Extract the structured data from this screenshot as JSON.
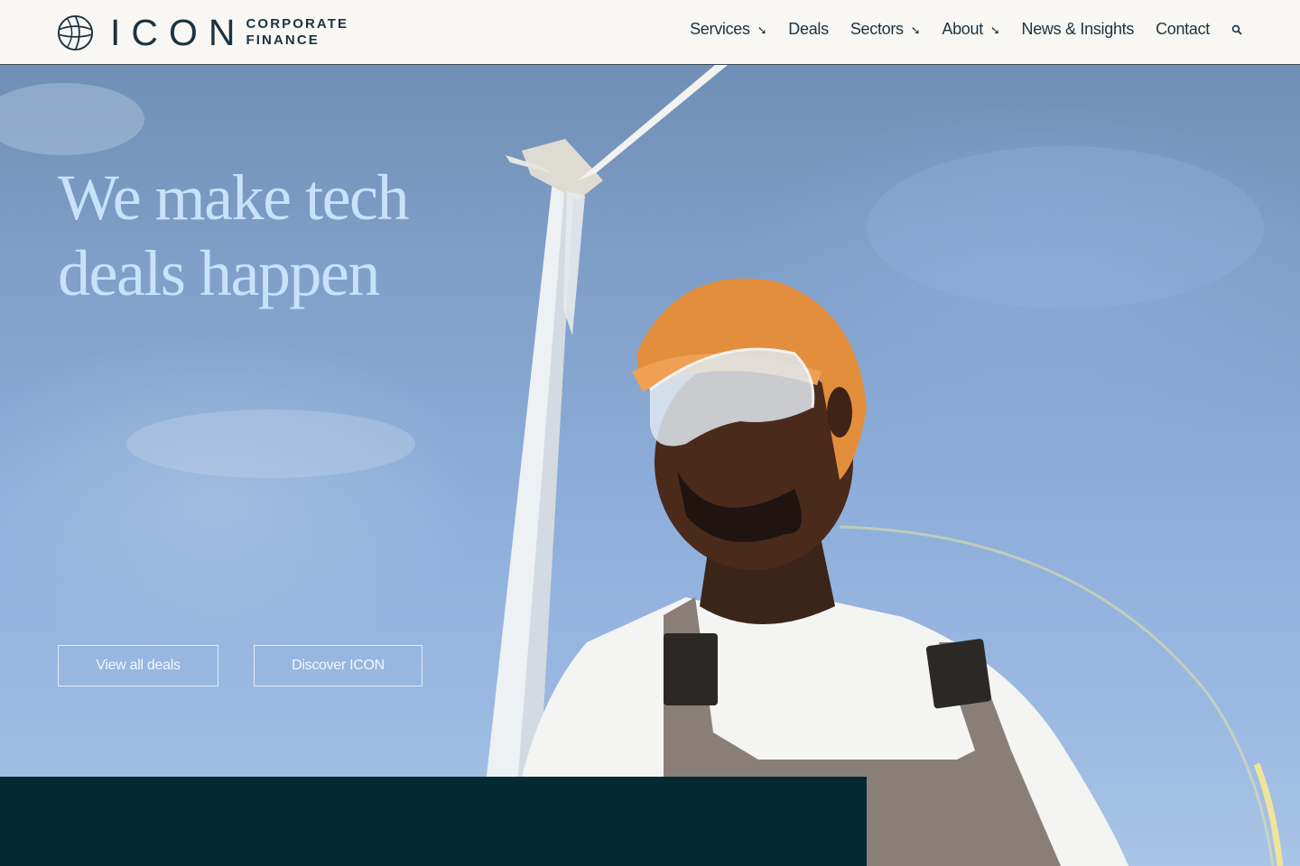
{
  "brand": {
    "name": "ICON",
    "sub_line_1": "CORPORATE",
    "sub_line_2": "FINANCE",
    "logo_icon": "globe-icon"
  },
  "nav": {
    "items": [
      {
        "label": "Services",
        "has_dropdown": true
      },
      {
        "label": "Deals",
        "has_dropdown": false
      },
      {
        "label": "Sectors",
        "has_dropdown": true
      },
      {
        "label": "About",
        "has_dropdown": true
      },
      {
        "label": "News & Insights",
        "has_dropdown": false
      },
      {
        "label": "Contact",
        "has_dropdown": false
      }
    ],
    "dropdown_icon": "arrow-down-right-icon",
    "search_icon": "search-icon"
  },
  "hero": {
    "headline_line_1": "We make tech",
    "headline_line_2": "deals happen",
    "image_subject": "worker in hard hat and safety glasses beneath a wind turbine",
    "buttons": {
      "view_deals": "View all deals",
      "discover": "Discover ICON"
    }
  },
  "colors": {
    "header_bg": "#f8f7f4",
    "brand_navy": "#1c3340",
    "headline": "#c9e2fb",
    "panel": "#032a33",
    "accent_curve": "#e8e0a0"
  }
}
